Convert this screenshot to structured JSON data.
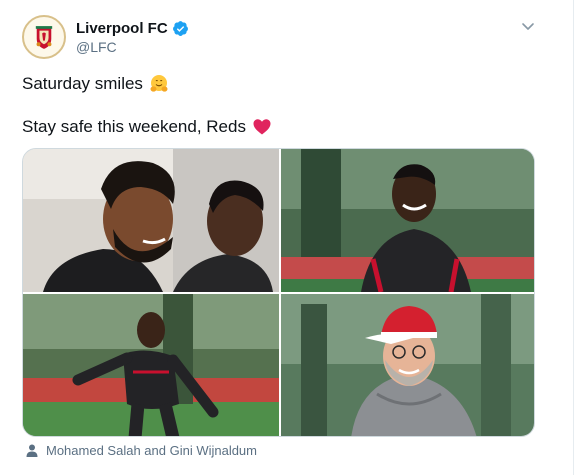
{
  "account": {
    "display_name": "Liverpool FC",
    "handle": "@LFC",
    "verified": true
  },
  "tweet": {
    "line1_text": "Saturday smiles",
    "line1_emoji": "hugging-face-emoji",
    "line2_text": "Stay safe this weekend, Reds",
    "line2_emoji": "red-heart-emoji"
  },
  "media": {
    "images": [
      {
        "name": "photo-salah-wijnaldum"
      },
      {
        "name": "photo-wijnaldum-smiling"
      },
      {
        "name": "photo-mane-running"
      },
      {
        "name": "photo-klopp-cap"
      }
    ]
  },
  "tagged": {
    "icon": "person-icon",
    "text": "Mohamed Salah and Gini Wijnaldum"
  },
  "colors": {
    "verified_blue": "#1da1f2",
    "secondary_text": "#5b7083",
    "lfc_red": "#c8102e",
    "heart_red": "#e0245e"
  }
}
